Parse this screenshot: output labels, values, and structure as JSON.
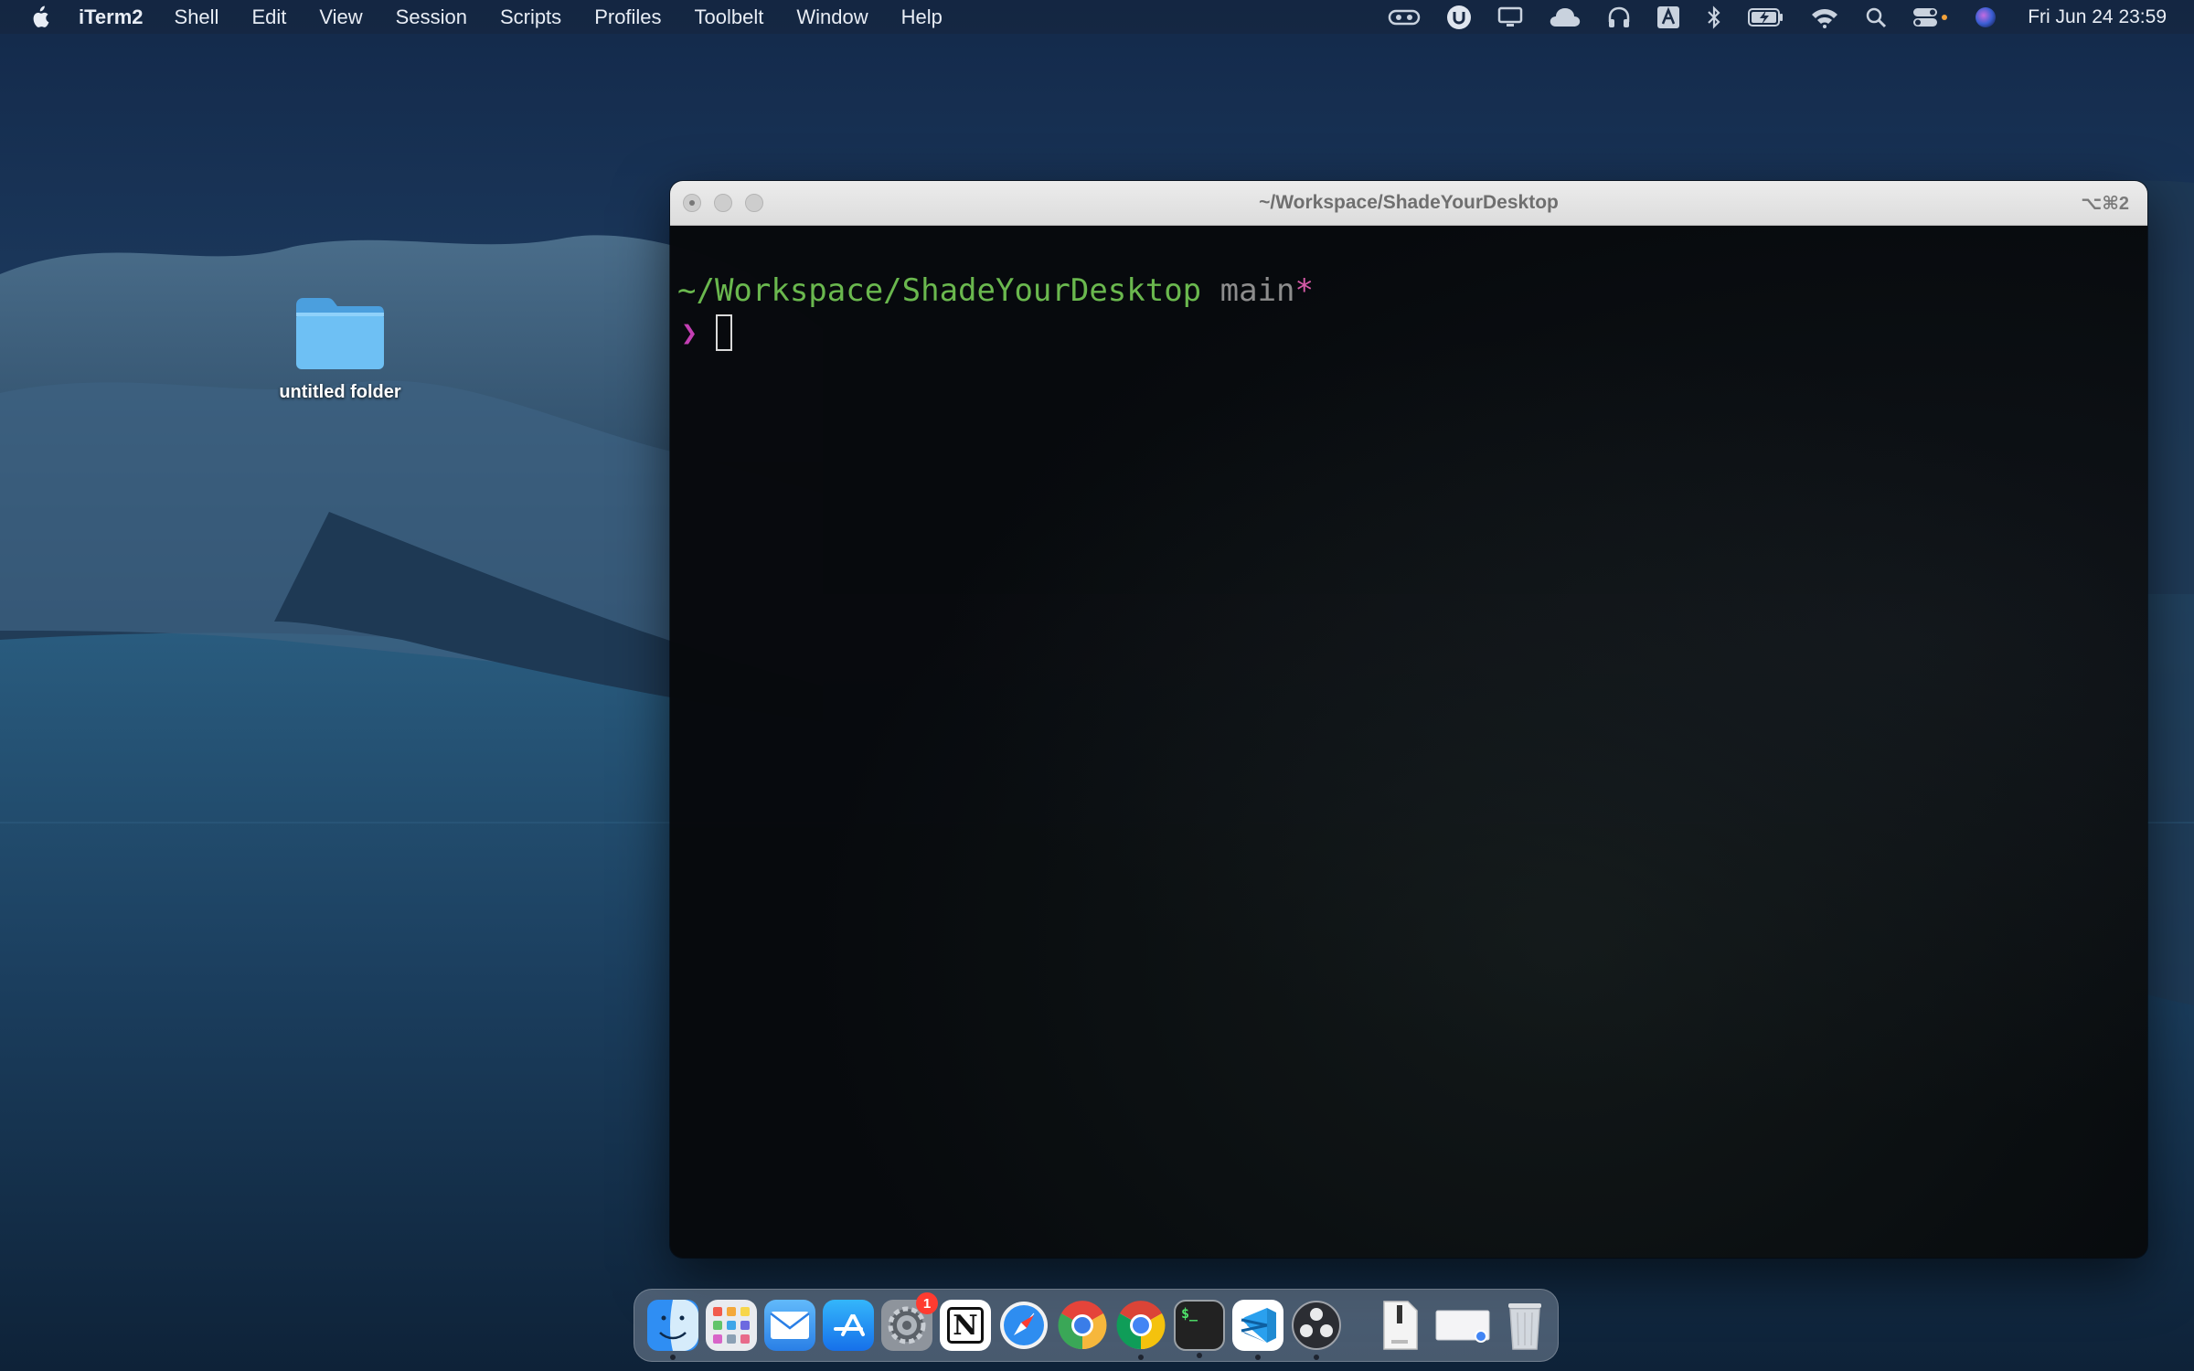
{
  "menubar": {
    "app_name": "iTerm2",
    "items": [
      "Shell",
      "Edit",
      "View",
      "Session",
      "Scripts",
      "Profiles",
      "Toolbelt",
      "Window",
      "Help"
    ],
    "status_icons": [
      "vr-headset-icon",
      "ubiquiti-icon",
      "display-icon",
      "cloud-icon",
      "headphones-icon",
      "keyboard-input-a-icon",
      "bluetooth-icon",
      "battery-charging-icon",
      "wifi-icon",
      "spotlight-search-icon",
      "control-center-icon",
      "siri-icon"
    ],
    "clock": "Fri Jun 24  23:59"
  },
  "desktop": {
    "folder_label": "untitled folder"
  },
  "terminal": {
    "title": "~/Workspace/ShadeYourDesktop",
    "shortcut": "⌥⌘2",
    "prompt_path": "~/Workspace/ShadeYourDesktop",
    "prompt_branch": "main",
    "prompt_dirty": "*",
    "prompt_symbol": "❯"
  },
  "dock": {
    "apps": [
      {
        "name": "finder",
        "running": true
      },
      {
        "name": "launchpad",
        "running": false
      },
      {
        "name": "mail",
        "running": false
      },
      {
        "name": "app-store",
        "running": false
      },
      {
        "name": "system-preferences",
        "running": false,
        "badge": "1"
      },
      {
        "name": "notion",
        "running": false
      },
      {
        "name": "safari",
        "running": false
      },
      {
        "name": "chrome-canary",
        "running": false
      },
      {
        "name": "chrome",
        "running": true
      },
      {
        "name": "iterm2",
        "running": true
      },
      {
        "name": "vscode",
        "running": true
      },
      {
        "name": "obs",
        "running": true
      }
    ],
    "notion_letter": "N",
    "terminal_glyph": "$_"
  },
  "colors": {
    "prompt_path": "#6ab84e",
    "prompt_branch": "#8d8d8d",
    "prompt_dirty": "#d65aa7",
    "prompt_symbol": "#c33fb3",
    "folder_blue": "#64b8f0"
  }
}
